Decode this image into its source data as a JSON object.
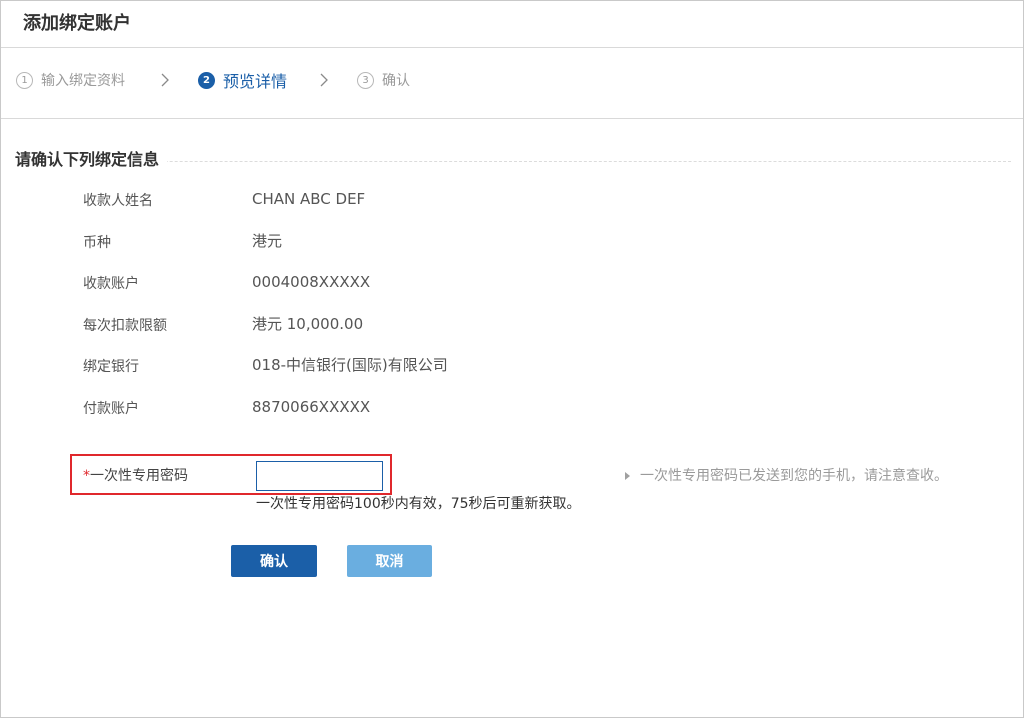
{
  "header": {
    "title": "添加绑定账户"
  },
  "steps": [
    {
      "number": "1",
      "label": "输入绑定资料",
      "active": false
    },
    {
      "number": "2",
      "label": "预览详情",
      "active": true
    },
    {
      "number": "3",
      "label": "确认",
      "active": false
    }
  ],
  "section": {
    "title": "请确认下列绑定信息"
  },
  "details": [
    {
      "label": "收款人姓名",
      "value": "CHAN ABC DEF"
    },
    {
      "label": "币种",
      "value": "港元"
    },
    {
      "label": "收款账户",
      "value": "0004008XXXXX"
    },
    {
      "label": "每次扣款限额",
      "value": "港元 10,000.00"
    },
    {
      "label": "绑定银行",
      "value": "018-中信银行(国际)有限公司"
    },
    {
      "label": "付款账户",
      "value": "8870066XXXXX"
    }
  ],
  "otp": {
    "required_mark": "*",
    "label": "一次性专用密码",
    "value": "",
    "validity_hint": "一次性专用密码100秒内有效，75秒后可重新获取。",
    "sent_note": "一次性专用密码已发送到您的手机，请注意查收。"
  },
  "buttons": {
    "confirm": "确认",
    "cancel": "取消"
  },
  "colors": {
    "primary": "#1b5fa8",
    "secondary_button": "#6aaee0",
    "highlight_border": "#e0282c",
    "required": "#e0282c"
  }
}
